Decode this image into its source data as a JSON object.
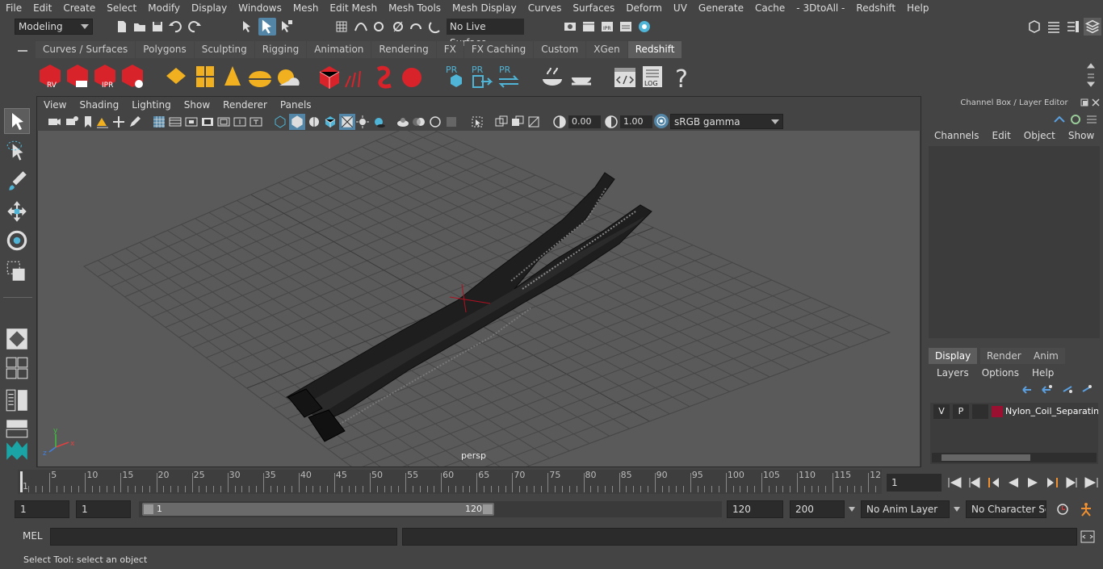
{
  "menubar": {
    "items": [
      "File",
      "Edit",
      "Create",
      "Select",
      "Modify",
      "Display",
      "Windows",
      "Mesh",
      "Edit Mesh",
      "Mesh Tools",
      "Mesh Display",
      "Curves",
      "Surfaces",
      "Deform",
      "UV",
      "Generate",
      "Cache",
      "- 3DtoAll -",
      "Redshift",
      "Help"
    ]
  },
  "statusline": {
    "menuset": "Modeling",
    "live_surface": "No Live Surface"
  },
  "shelf": {
    "tabs": [
      "Curves / Surfaces",
      "Polygons",
      "Sculpting",
      "Rigging",
      "Animation",
      "Rendering",
      "FX",
      "FX Caching",
      "Custom",
      "XGen",
      "Redshift"
    ],
    "active_tab": "Redshift",
    "icon_labels": {
      "rv": "RV",
      "ipr": "IPR",
      "pr1": "PR",
      "pr2": "PR",
      "pr3": "PR",
      "log": "LOG",
      "help": "?"
    }
  },
  "viewport": {
    "menu": [
      "View",
      "Shading",
      "Lighting",
      "Show",
      "Renderer",
      "Panels"
    ],
    "exposure": "0.00",
    "gamma": "1.00",
    "color_space": "sRGB gamma",
    "camera_label": "persp",
    "axis_x": "x",
    "axis_y": "y",
    "axis_z": "z"
  },
  "channelbox": {
    "title": "Channel Box / Layer Editor",
    "menu": [
      "Channels",
      "Edit",
      "Object",
      "Show"
    ],
    "tabs": [
      "Display",
      "Render",
      "Anim"
    ],
    "active_tab": "Display",
    "layer_menu": [
      "Layers",
      "Options",
      "Help"
    ],
    "layer": {
      "v": "V",
      "p": "P",
      "name": "Nylon_Coil_Separating",
      "color": "#9b1030"
    }
  },
  "timeslider": {
    "ticks": [
      "1",
      "5",
      "10",
      "15",
      "20",
      "25",
      "30",
      "35",
      "40",
      "45",
      "50",
      "55",
      "60",
      "65",
      "70",
      "75",
      "80",
      "85",
      "90",
      "95",
      "100",
      "105",
      "110",
      "115",
      "12"
    ],
    "current_frame": "1"
  },
  "rangebar": {
    "start": "1",
    "start_inner": "1",
    "range_start": "1",
    "range_end": "120",
    "end": "120",
    "anim_end": "200",
    "anim_layer": "No Anim Layer",
    "char_set": "No Character Set"
  },
  "commandline": {
    "label": "MEL"
  },
  "helpline": {
    "text": "Select Tool: select an object"
  },
  "colors": {
    "background": "#444444",
    "viewport": "#5a5a5a",
    "accent": "#5285a6",
    "redshift_red": "#d8232a"
  }
}
